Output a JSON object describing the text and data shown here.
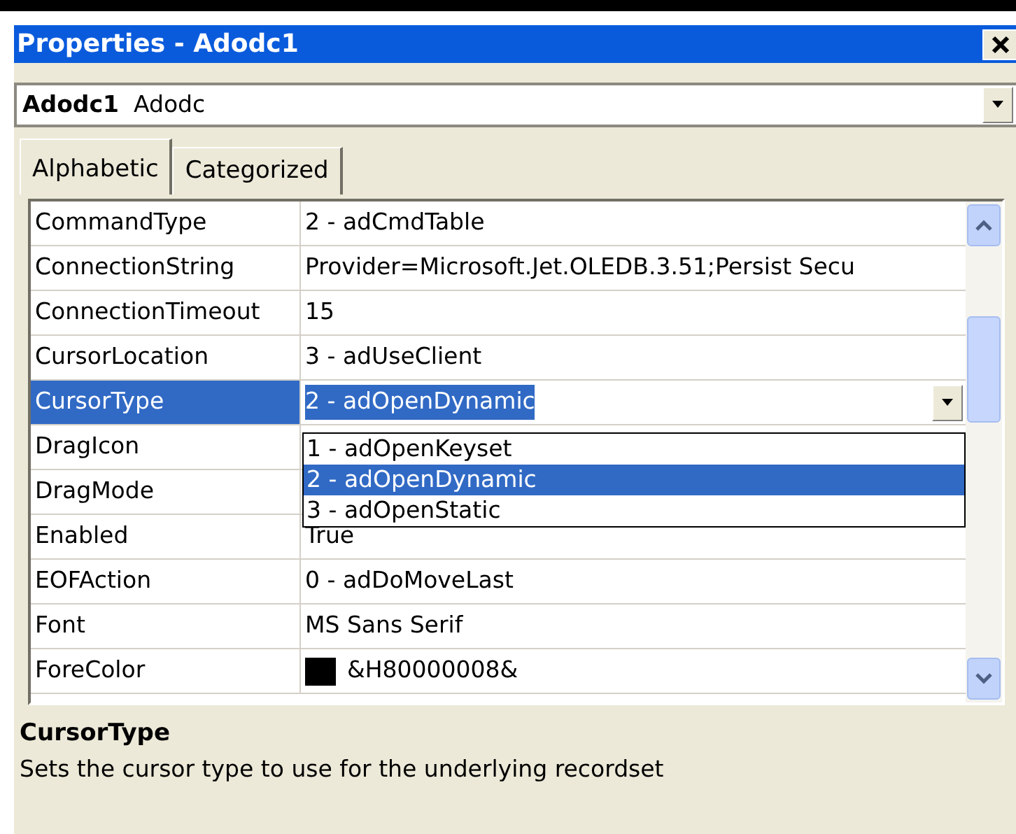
{
  "window": {
    "title": "Properties - Adodc1"
  },
  "object_selector": {
    "name": "Adodc1",
    "type": "Adodc"
  },
  "tabs": [
    {
      "label": "Alphabetic",
      "selected": true
    },
    {
      "label": "Categorized",
      "selected": false
    }
  ],
  "properties": [
    {
      "name": "CommandType",
      "value": "2 - adCmdTable",
      "selected": false,
      "kind": "text"
    },
    {
      "name": "ConnectionString",
      "value": "Provider=Microsoft.Jet.OLEDB.3.51;Persist Secu",
      "selected": false,
      "kind": "text"
    },
    {
      "name": "ConnectionTimeout",
      "value": "15",
      "selected": false,
      "kind": "text"
    },
    {
      "name": "CursorLocation",
      "value": "3 - adUseClient",
      "selected": false,
      "kind": "text"
    },
    {
      "name": "CursorType",
      "value": "2 - adOpenDynamic",
      "selected": true,
      "kind": "dropdown"
    },
    {
      "name": "DragIcon",
      "selected": false,
      "kind": "text"
    },
    {
      "name": "DragMode",
      "selected": false,
      "kind": "text"
    },
    {
      "name": "Enabled",
      "value": "True",
      "selected": false,
      "kind": "text"
    },
    {
      "name": "EOFAction",
      "value": "0 - adDoMoveLast",
      "selected": false,
      "kind": "text"
    },
    {
      "name": "Font",
      "value": "MS Sans Serif",
      "selected": false,
      "kind": "text"
    },
    {
      "name": "ForeColor",
      "value": "&H80000008&",
      "selected": false,
      "kind": "color",
      "color": "#000000"
    }
  ],
  "dropdown": {
    "options": [
      {
        "label": "1 - adOpenKeyset",
        "selected": false
      },
      {
        "label": "2 - adOpenDynamic",
        "selected": true
      },
      {
        "label": "3 - adOpenStatic",
        "selected": false
      }
    ]
  },
  "description": {
    "title": "CursorType",
    "text": "Sets the cursor type to use for the underlying recordset"
  }
}
